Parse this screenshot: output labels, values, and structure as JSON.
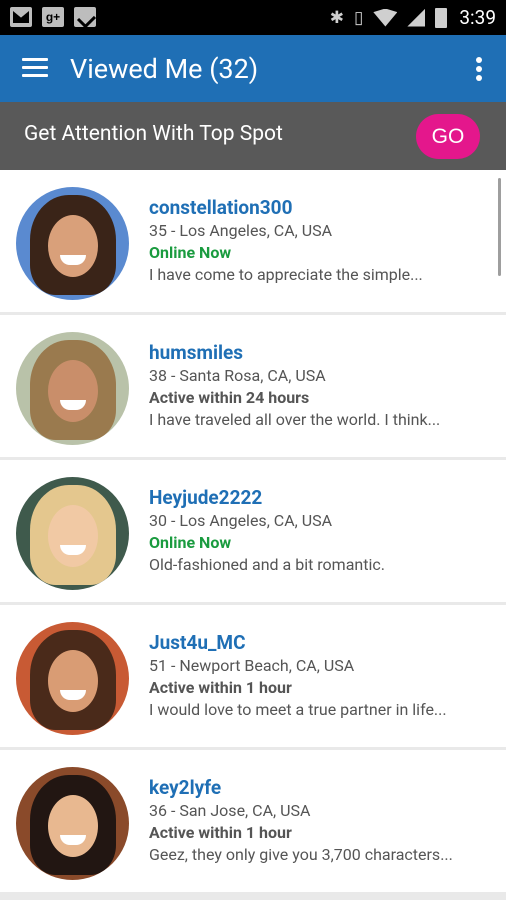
{
  "status_bar": {
    "time": "3:39"
  },
  "app_bar": {
    "title": "Viewed Me (32)"
  },
  "promo": {
    "text": "Get Attention With Top Spot",
    "button": "GO"
  },
  "profiles": [
    {
      "username": "constellation300",
      "meta": "35 - Los Angeles, CA, USA",
      "status": "Online Now",
      "status_type": "online",
      "snippet": "I have come to appreciate the simple...",
      "colors": {
        "bg": "#5a8ad0",
        "hair": "#3a2418",
        "skin": "#d9a07a"
      }
    },
    {
      "username": "humsmiles",
      "meta": "38 - Santa Rosa, CA, USA",
      "status": "Active within 24 hours",
      "status_type": "active",
      "snippet": "I have traveled all over the world. I think...",
      "colors": {
        "bg": "#b9c2a9",
        "hair": "#9a7a4e",
        "skin": "#c98e6a"
      }
    },
    {
      "username": "Heyjude2222",
      "meta": "30 - Los Angeles, CA, USA",
      "status": "Online Now",
      "status_type": "online",
      "snippet": "Old-fashioned and a bit romantic.",
      "colors": {
        "bg": "#3f5a4c",
        "hair": "#e4c78e",
        "skin": "#f1c9a4"
      }
    },
    {
      "username": "Just4u_MC",
      "meta": "51 - Newport Beach, CA, USA",
      "status": "Active within 1 hour",
      "status_type": "active",
      "snippet": "I would love to meet a true partner in life...",
      "colors": {
        "bg": "#c85a34",
        "hair": "#4a2a1a",
        "skin": "#d99c74"
      }
    },
    {
      "username": "key2lyfe",
      "meta": "36 - San Jose, CA, USA",
      "status": "Active within 1 hour",
      "status_type": "active",
      "snippet": "Geez, they only give you 3,700 characters...",
      "colors": {
        "bg": "#8a4a2a",
        "hair": "#221612",
        "skin": "#e8b890"
      }
    }
  ]
}
